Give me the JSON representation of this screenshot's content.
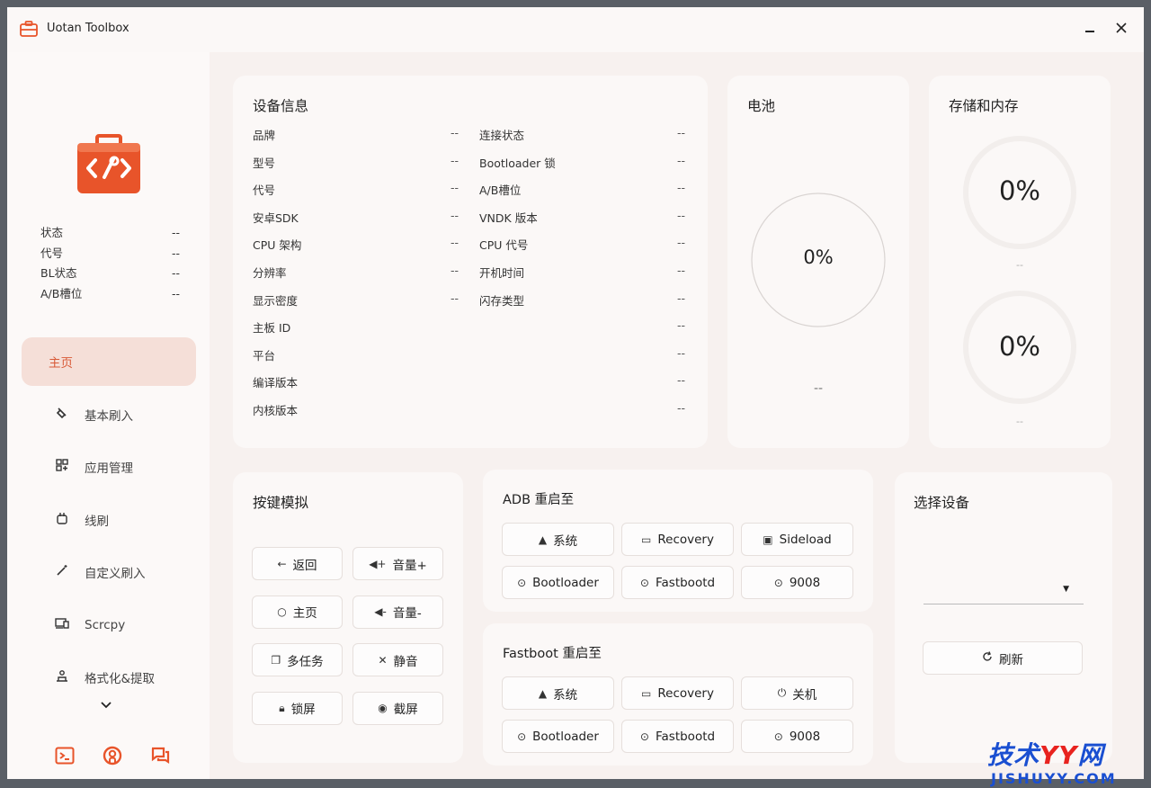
{
  "window": {
    "title": "Uotan Toolbox"
  },
  "sidebar": {
    "status": [
      {
        "label": "状态",
        "value": "--"
      },
      {
        "label": "代号",
        "value": "--"
      },
      {
        "label": "BL状态",
        "value": "--"
      },
      {
        "label": "A/B槽位",
        "value": "--"
      }
    ],
    "nav": [
      {
        "label": "主页",
        "icon": "home",
        "active": true
      },
      {
        "label": "基本刷入",
        "icon": "flash-icon"
      },
      {
        "label": "应用管理",
        "icon": "apps-icon"
      },
      {
        "label": "线刷",
        "icon": "line-flash-icon"
      },
      {
        "label": "自定义刷入",
        "icon": "wand-icon"
      },
      {
        "label": "Scrcpy",
        "icon": "screen-mirror-icon"
      },
      {
        "label": "格式化&提取",
        "icon": "format-icon"
      }
    ]
  },
  "device_info": {
    "title": "设备信息",
    "left": [
      {
        "label": "品牌",
        "value": "--"
      },
      {
        "label": "型号",
        "value": "--"
      },
      {
        "label": "代号",
        "value": "--"
      },
      {
        "label": "安卓SDK",
        "value": "--"
      },
      {
        "label": "CPU 架构",
        "value": "--"
      },
      {
        "label": "分辨率",
        "value": "--"
      },
      {
        "label": "显示密度",
        "value": "--"
      },
      {
        "label": "主板 ID",
        "value": "--"
      },
      {
        "label": "平台",
        "value": "--"
      },
      {
        "label": "编译版本",
        "value": "--"
      },
      {
        "label": "内核版本",
        "value": "--"
      }
    ],
    "right": [
      {
        "label": "连接状态",
        "value": "--"
      },
      {
        "label": "Bootloader 锁",
        "value": "--"
      },
      {
        "label": "A/B槽位",
        "value": "--"
      },
      {
        "label": "VNDK 版本",
        "value": "--"
      },
      {
        "label": "CPU 代号",
        "value": "--"
      },
      {
        "label": "开机时间",
        "value": "--"
      },
      {
        "label": "闪存类型",
        "value": "--"
      }
    ]
  },
  "battery": {
    "title": "电池",
    "percent": "0%",
    "level": 0,
    "detail": "--"
  },
  "storage": {
    "title": "存储和内存",
    "storage_percent": "0%",
    "storage_level": 0,
    "storage_detail": "--",
    "memory_percent": "0%",
    "memory_level": 0,
    "memory_detail": "--"
  },
  "keys": {
    "title": "按键模拟",
    "buttons": [
      {
        "label": "返回",
        "icon": "arrow-left-icon"
      },
      {
        "label": "音量+",
        "icon": "volume-up-icon"
      },
      {
        "label": "主页",
        "icon": "circle-icon"
      },
      {
        "label": "音量-",
        "icon": "volume-down-icon"
      },
      {
        "label": "多任务",
        "icon": "multitask-icon"
      },
      {
        "label": "静音",
        "icon": "mute-icon"
      },
      {
        "label": "锁屏",
        "icon": "lock-icon"
      },
      {
        "label": "截屏",
        "icon": "camera-icon"
      }
    ]
  },
  "adb_reboot": {
    "title": "ADB 重启至",
    "buttons": [
      {
        "label": "系统",
        "icon": "android-icon"
      },
      {
        "label": "Recovery",
        "icon": "monitor-icon"
      },
      {
        "label": "Sideload",
        "icon": "sideload-icon"
      },
      {
        "label": "Bootloader",
        "icon": "reboot-icon"
      },
      {
        "label": "Fastbootd",
        "icon": "reboot-icon"
      },
      {
        "label": "9008",
        "icon": "reboot-icon"
      }
    ]
  },
  "fastboot_reboot": {
    "title": "Fastboot 重启至",
    "buttons": [
      {
        "label": "系统",
        "icon": "android-icon"
      },
      {
        "label": "Recovery",
        "icon": "monitor-icon"
      },
      {
        "label": "关机",
        "icon": "power-icon"
      },
      {
        "label": "Bootloader",
        "icon": "reboot-icon"
      },
      {
        "label": "Fastbootd",
        "icon": "reboot-icon"
      },
      {
        "label": "9008",
        "icon": "reboot-icon"
      }
    ]
  },
  "select_device": {
    "title": "选择设备",
    "selected": "",
    "refresh_label": "刷新"
  },
  "watermark": {
    "main_prefix": "技术",
    "main_yy": "YY",
    "main_suffix": "网",
    "sub": "JISHUYY.COM"
  },
  "colors": {
    "accent": "#e8542a",
    "active_bg": "#f5dfd8",
    "active_text": "#d85a38"
  }
}
